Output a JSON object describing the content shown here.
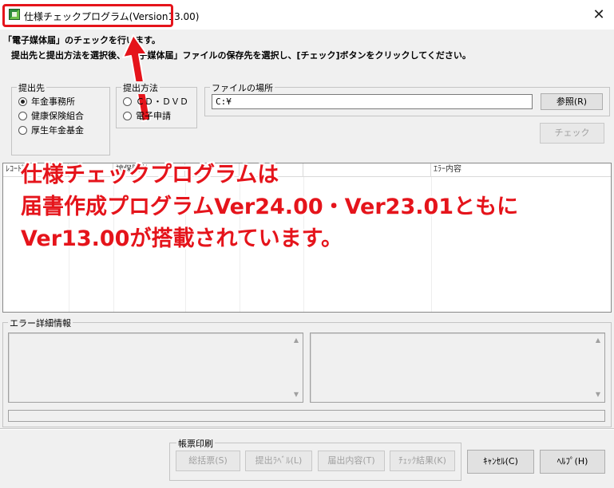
{
  "window": {
    "title": "仕様チェックプログラム(Version13.00)",
    "close_glyph": "✕"
  },
  "instructions": {
    "line1": "「電子媒体届」のチェックを行います。",
    "line2": "提出先と提出方法を選択後、「電子媒体届」ファイルの保存先を選択し、[チェック]ボタンをクリックしてください。"
  },
  "submission_target": {
    "label": "提出先",
    "options": [
      {
        "label": "年金事務所",
        "selected": true
      },
      {
        "label": "健康保険組合",
        "selected": false
      },
      {
        "label": "厚生年金基金",
        "selected": false
      }
    ]
  },
  "submission_method": {
    "label": "提出方法",
    "options": [
      {
        "label": "ＣＤ・ＤＶＤ",
        "selected": false
      },
      {
        "label": "電子申請",
        "selected": false
      }
    ]
  },
  "file_location": {
    "label": "ファイルの場所",
    "value": "C:¥",
    "browse_label": "参照(R)"
  },
  "check_button": "チェック",
  "results_table": {
    "columns": [
      "ﾚｺｰﾄﾞ",
      "",
      "被保険者",
      "",
      "",
      "",
      "ｴﾗｰ内容"
    ]
  },
  "annotation": {
    "line1": "仕様チェックプログラムは",
    "line2": "届書作成プログラムVer24.00・Ver23.01ともに",
    "line3": "Ver13.00が搭載されています。"
  },
  "error_detail": {
    "label": "エラー詳細情報"
  },
  "report_print": {
    "label": "帳票印刷",
    "buttons": [
      "総括票(S)",
      "提出ﾗﾍﾞﾙ(L)",
      "届出内容(T)",
      "ﾁｪｯｸ結果(K)"
    ]
  },
  "cancel_button": "ｷｬﾝｾﾙ(C)",
  "help_button": "ﾍﾙﾌﾟ(H)",
  "colors": {
    "highlight_red": "#e5141b",
    "window_bg": "#f0f0f0"
  }
}
